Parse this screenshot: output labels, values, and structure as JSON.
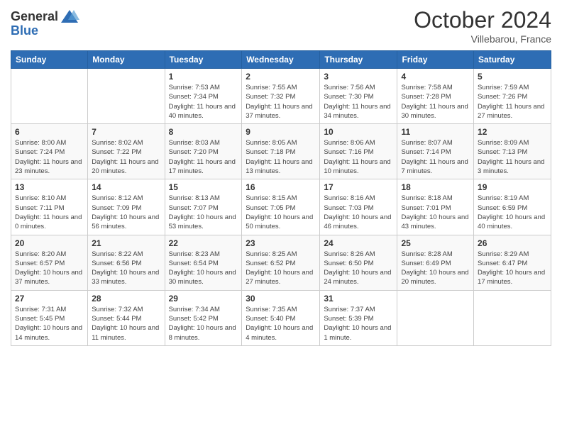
{
  "header": {
    "logo_general": "General",
    "logo_blue": "Blue",
    "month_title": "October 2024",
    "location": "Villebarou, France"
  },
  "days_of_week": [
    "Sunday",
    "Monday",
    "Tuesday",
    "Wednesday",
    "Thursday",
    "Friday",
    "Saturday"
  ],
  "weeks": [
    [
      {
        "day": "",
        "detail": ""
      },
      {
        "day": "",
        "detail": ""
      },
      {
        "day": "1",
        "detail": "Sunrise: 7:53 AM\nSunset: 7:34 PM\nDaylight: 11 hours and 40 minutes."
      },
      {
        "day": "2",
        "detail": "Sunrise: 7:55 AM\nSunset: 7:32 PM\nDaylight: 11 hours and 37 minutes."
      },
      {
        "day": "3",
        "detail": "Sunrise: 7:56 AM\nSunset: 7:30 PM\nDaylight: 11 hours and 34 minutes."
      },
      {
        "day": "4",
        "detail": "Sunrise: 7:58 AM\nSunset: 7:28 PM\nDaylight: 11 hours and 30 minutes."
      },
      {
        "day": "5",
        "detail": "Sunrise: 7:59 AM\nSunset: 7:26 PM\nDaylight: 11 hours and 27 minutes."
      }
    ],
    [
      {
        "day": "6",
        "detail": "Sunrise: 8:00 AM\nSunset: 7:24 PM\nDaylight: 11 hours and 23 minutes."
      },
      {
        "day": "7",
        "detail": "Sunrise: 8:02 AM\nSunset: 7:22 PM\nDaylight: 11 hours and 20 minutes."
      },
      {
        "day": "8",
        "detail": "Sunrise: 8:03 AM\nSunset: 7:20 PM\nDaylight: 11 hours and 17 minutes."
      },
      {
        "day": "9",
        "detail": "Sunrise: 8:05 AM\nSunset: 7:18 PM\nDaylight: 11 hours and 13 minutes."
      },
      {
        "day": "10",
        "detail": "Sunrise: 8:06 AM\nSunset: 7:16 PM\nDaylight: 11 hours and 10 minutes."
      },
      {
        "day": "11",
        "detail": "Sunrise: 8:07 AM\nSunset: 7:14 PM\nDaylight: 11 hours and 7 minutes."
      },
      {
        "day": "12",
        "detail": "Sunrise: 8:09 AM\nSunset: 7:13 PM\nDaylight: 11 hours and 3 minutes."
      }
    ],
    [
      {
        "day": "13",
        "detail": "Sunrise: 8:10 AM\nSunset: 7:11 PM\nDaylight: 11 hours and 0 minutes."
      },
      {
        "day": "14",
        "detail": "Sunrise: 8:12 AM\nSunset: 7:09 PM\nDaylight: 10 hours and 56 minutes."
      },
      {
        "day": "15",
        "detail": "Sunrise: 8:13 AM\nSunset: 7:07 PM\nDaylight: 10 hours and 53 minutes."
      },
      {
        "day": "16",
        "detail": "Sunrise: 8:15 AM\nSunset: 7:05 PM\nDaylight: 10 hours and 50 minutes."
      },
      {
        "day": "17",
        "detail": "Sunrise: 8:16 AM\nSunset: 7:03 PM\nDaylight: 10 hours and 46 minutes."
      },
      {
        "day": "18",
        "detail": "Sunrise: 8:18 AM\nSunset: 7:01 PM\nDaylight: 10 hours and 43 minutes."
      },
      {
        "day": "19",
        "detail": "Sunrise: 8:19 AM\nSunset: 6:59 PM\nDaylight: 10 hours and 40 minutes."
      }
    ],
    [
      {
        "day": "20",
        "detail": "Sunrise: 8:20 AM\nSunset: 6:57 PM\nDaylight: 10 hours and 37 minutes."
      },
      {
        "day": "21",
        "detail": "Sunrise: 8:22 AM\nSunset: 6:56 PM\nDaylight: 10 hours and 33 minutes."
      },
      {
        "day": "22",
        "detail": "Sunrise: 8:23 AM\nSunset: 6:54 PM\nDaylight: 10 hours and 30 minutes."
      },
      {
        "day": "23",
        "detail": "Sunrise: 8:25 AM\nSunset: 6:52 PM\nDaylight: 10 hours and 27 minutes."
      },
      {
        "day": "24",
        "detail": "Sunrise: 8:26 AM\nSunset: 6:50 PM\nDaylight: 10 hours and 24 minutes."
      },
      {
        "day": "25",
        "detail": "Sunrise: 8:28 AM\nSunset: 6:49 PM\nDaylight: 10 hours and 20 minutes."
      },
      {
        "day": "26",
        "detail": "Sunrise: 8:29 AM\nSunset: 6:47 PM\nDaylight: 10 hours and 17 minutes."
      }
    ],
    [
      {
        "day": "27",
        "detail": "Sunrise: 7:31 AM\nSunset: 5:45 PM\nDaylight: 10 hours and 14 minutes."
      },
      {
        "day": "28",
        "detail": "Sunrise: 7:32 AM\nSunset: 5:44 PM\nDaylight: 10 hours and 11 minutes."
      },
      {
        "day": "29",
        "detail": "Sunrise: 7:34 AM\nSunset: 5:42 PM\nDaylight: 10 hours and 8 minutes."
      },
      {
        "day": "30",
        "detail": "Sunrise: 7:35 AM\nSunset: 5:40 PM\nDaylight: 10 hours and 4 minutes."
      },
      {
        "day": "31",
        "detail": "Sunrise: 7:37 AM\nSunset: 5:39 PM\nDaylight: 10 hours and 1 minute."
      },
      {
        "day": "",
        "detail": ""
      },
      {
        "day": "",
        "detail": ""
      }
    ]
  ]
}
